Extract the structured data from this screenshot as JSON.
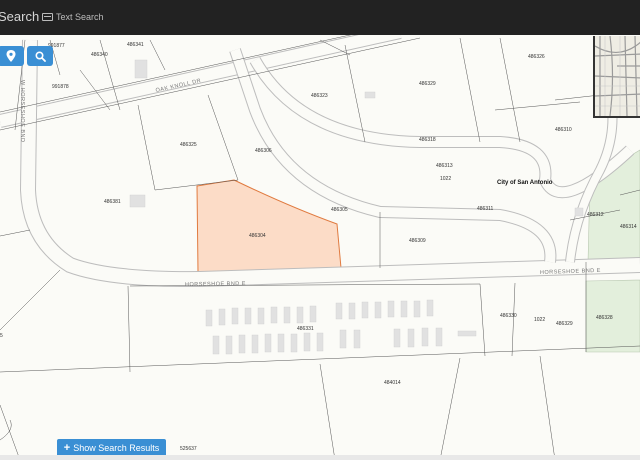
{
  "app": {
    "title": "Search",
    "text_search_label": "Text Search"
  },
  "controls": {
    "locate_icon": "map-pin-icon",
    "search_icon": "magnifier-icon",
    "show_results_label": "Show Search Results"
  },
  "colors": {
    "accent": "#3a8fd4",
    "selected_parcel": "#fcdcc7",
    "selected_parcel_border": "#e07a3f",
    "topbar": "#222222",
    "green_parcel": "#e3efdc"
  },
  "map": {
    "city_label": "City of San Antonio",
    "streets": {
      "oak_knoll": "OAK KNOLL DR",
      "horseshoe_left": "HORSESHOE BND E",
      "horseshoe_right": "HORSESHOE BND E",
      "w_horseshoe": "W HORSESHOE BND"
    },
    "parcels": {
      "p486341": "486341",
      "p486340": "486340",
      "p991877": "991877",
      "p991878": "991878",
      "p486323": "486323",
      "p486329": "486329",
      "p486326": "486326",
      "p486310": "486310",
      "p486318": "486318",
      "p486313": "486313",
      "p1022a": "1022",
      "p486325": "486325",
      "p486306": "486306",
      "p486381": "486381",
      "p486305": "486305",
      "p486311": "486311",
      "p486304": "486304",
      "p486309": "486309",
      "p486312": "486312",
      "p486314": "486314",
      "p486331": "486331",
      "p486330": "486330",
      "p1022b": "1022",
      "p486329b": "486329",
      "p486328": "486328",
      "p484014": "484014",
      "p525637": "525637",
      "p5a": "5"
    }
  }
}
